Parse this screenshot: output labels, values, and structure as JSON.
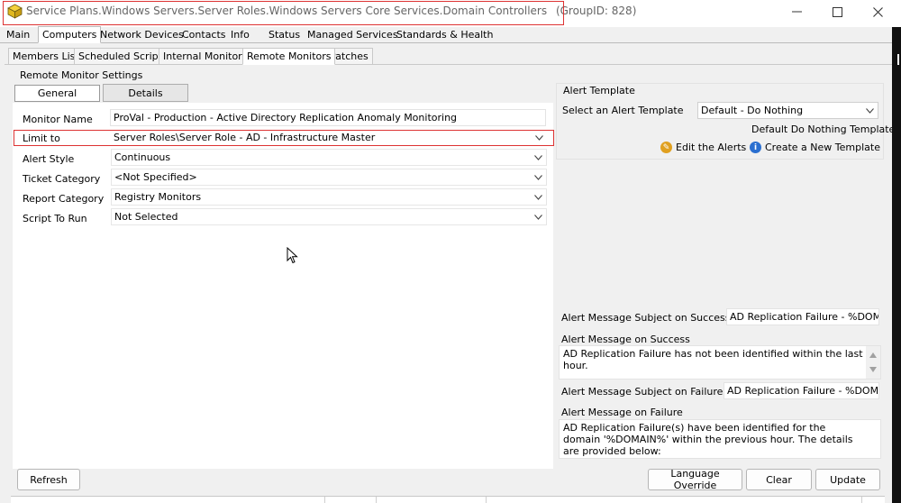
{
  "window": {
    "title": "Service Plans.Windows Servers.Server Roles.Windows Servers Core Services.Domain Controllers",
    "group_id": "(GroupID: 828)"
  },
  "main_tabs": [
    "Main",
    "Computers",
    "Network Devices",
    "Contacts",
    "Info",
    "Status",
    "Managed Services",
    "Standards & Health"
  ],
  "sub_tabs": [
    "Members List",
    "Scheduled Scripts",
    "Internal Monitors",
    "Remote Monitors",
    "Patches"
  ],
  "group_box_title": "Remote Monitor Settings",
  "settings_tabs": {
    "general": "General",
    "details": "Details"
  },
  "fields": {
    "monitor_name": {
      "label": "Monitor Name",
      "value": "ProVal - Production - Active Directory Replication Anomaly Monitoring"
    },
    "limit_to": {
      "label": "Limit to",
      "value": "Server Roles\\Server Role - AD - Infrastructure Master"
    },
    "alert_style": {
      "label": "Alert Style",
      "value": "Continuous"
    },
    "ticket_category": {
      "label": "Ticket Category",
      "value": "<Not Specified>"
    },
    "report_category": {
      "label": "Report Category",
      "value": "Registry Monitors"
    },
    "script_to_run": {
      "label": "Script To Run",
      "value": "Not Selected"
    }
  },
  "alert_template": {
    "title": "Alert Template",
    "select_label": "Select an Alert Template",
    "selected": "Default - Do Nothing",
    "template_name": "Default Do Nothing Template",
    "edit_link": "Edit the Alerts",
    "create_link": "Create a New Template"
  },
  "messages": {
    "success_subject_label": "Alert Message Subject on Success:",
    "success_subject_value": "AD Replication Failure - %DOMAIN",
    "success_body_label": "Alert Message on Success",
    "success_body_value": "AD Replication Failure has not been identified within the last hour.",
    "failure_subject_label": "Alert Message Subject on Failure:",
    "failure_subject_value": "AD Replication Failure - %DOMAIN%",
    "failure_body_label": "Alert Message on Failure",
    "failure_body_value": "AD Replication Failure(s) have been identified for the domain '%DOMAIN%' within the previous hour. The details are provided below:"
  },
  "buttons": {
    "refresh": "Refresh",
    "language_override": "Language Override",
    "clear": "Clear",
    "update": "Update"
  },
  "colors": {
    "highlight": "#dd3333",
    "link_icon_edit": "#e0a020",
    "link_icon_info": "#2a6fd0"
  }
}
